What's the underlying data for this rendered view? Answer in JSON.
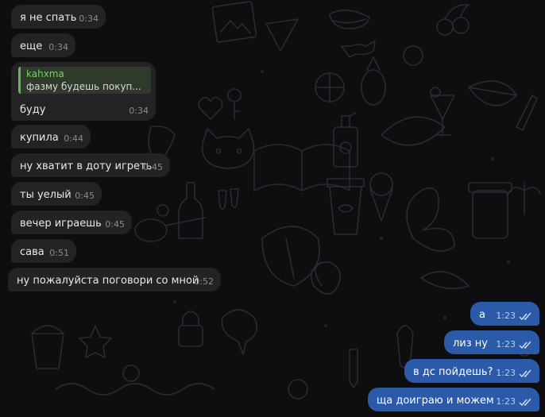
{
  "messages_in": [
    {
      "text": "я не спать",
      "time": "0:34"
    },
    {
      "text": "еще",
      "time": "0:34"
    },
    {
      "reply_name": "kahxma",
      "reply_text": "фазму будешь покуп...",
      "text": "буду",
      "time": "0:34"
    },
    {
      "text": "купила",
      "time": "0:44"
    },
    {
      "text": "ну хватит в доту игреть",
      "time": "0:45"
    },
    {
      "text": "ты уелый",
      "time": "0:45"
    },
    {
      "text": "вечер играешь",
      "time": "0:45"
    },
    {
      "text": "сава",
      "time": "0:51"
    },
    {
      "text": "ну пожалуйста поговори со мной",
      "time": "0:52"
    }
  ],
  "messages_out": [
    {
      "text": "а",
      "time": "1:23"
    },
    {
      "text": "лиз ну",
      "time": "1:23"
    },
    {
      "text": "в дс пойдешь?",
      "time": "1:23"
    },
    {
      "text": "ща доиграю и можем",
      "time": "1:23"
    }
  ],
  "icons": {
    "read_receipt": "double-check-icon",
    "wallpaper": "doodle-pattern"
  },
  "colors": {
    "background": "#0e0e10",
    "incoming": "#232326",
    "outgoing": "#2b5aa8",
    "reply_accent": "#5fbd4f"
  }
}
